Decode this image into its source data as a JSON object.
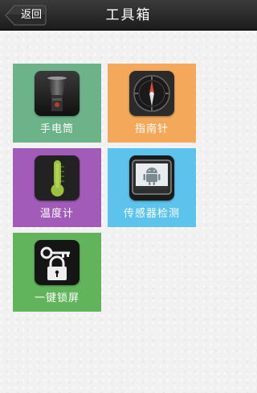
{
  "header": {
    "back_label": "返回",
    "title": "工具箱"
  },
  "tools": [
    {
      "label": "手电筒",
      "icon": "flashlight-icon",
      "color": "#6db38a"
    },
    {
      "label": "指南针",
      "icon": "compass-icon",
      "color": "#f3a85a"
    },
    {
      "label": "温度计",
      "icon": "thermometer-icon",
      "color": "#a25bb8"
    },
    {
      "label": "传感器检测",
      "icon": "android-tablet-icon",
      "color": "#5bc3ec"
    },
    {
      "label": "一键锁屏",
      "icon": "lock-key-icon",
      "color": "#61b45c"
    }
  ],
  "colors": {
    "header_bg": "#262626",
    "background": "#f1f1f1"
  }
}
